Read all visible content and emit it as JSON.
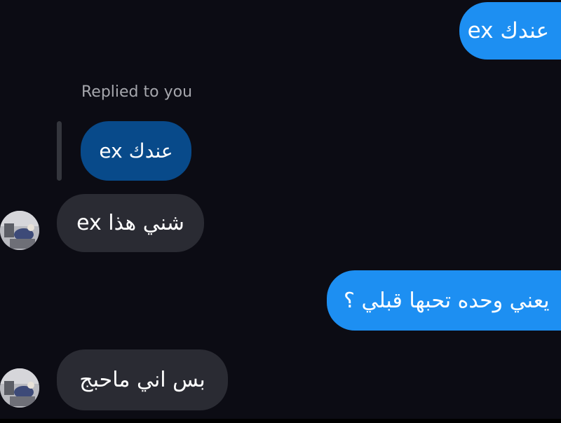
{
  "conversation": {
    "messages": [
      {
        "sender": "me",
        "text": "عندك ex"
      },
      {
        "sender": "them",
        "reply_label": "Replied to you",
        "quoted_text": "عندك ex",
        "text": "شني هذا ex"
      },
      {
        "sender": "me",
        "text": "يعني وحده تحبها قبلي ؟"
      },
      {
        "sender": "them",
        "text": "بس اني ماحبج"
      }
    ]
  },
  "colors": {
    "background": "#0c0c14",
    "sent_bubble": "#1d8ff2",
    "received_bubble": "#2a2b33",
    "quoted_bubble": "#084a8a",
    "reply_label": "#a6a7ad"
  },
  "icons": {
    "avatar": "user-avatar-photo"
  }
}
